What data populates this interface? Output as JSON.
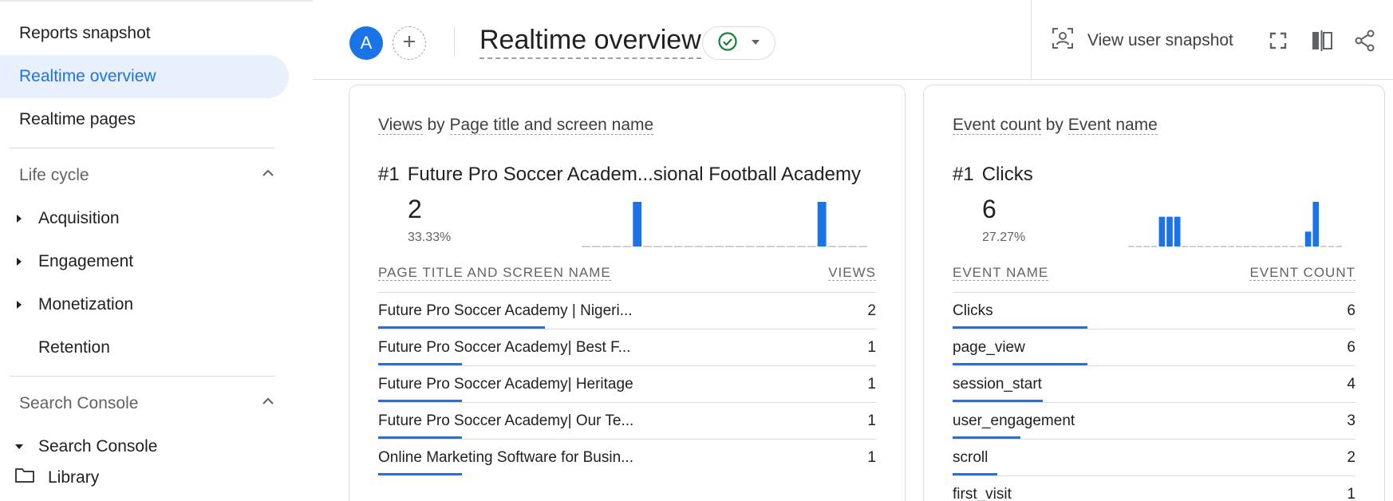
{
  "sidebar": {
    "items": [
      {
        "label": "Reports snapshot"
      },
      {
        "label": "Realtime overview"
      },
      {
        "label": "Realtime pages"
      }
    ],
    "sections": [
      {
        "label": "Life cycle",
        "children": [
          {
            "label": "Acquisition"
          },
          {
            "label": "Engagement"
          },
          {
            "label": "Monetization"
          },
          {
            "label": "Retention"
          }
        ]
      },
      {
        "label": "Search Console",
        "children": [
          {
            "label": "Search Console"
          }
        ]
      }
    ],
    "footer_label": "Library"
  },
  "header": {
    "avatar_letter": "A",
    "title": "Realtime overview",
    "view_snapshot_label": "View user snapshot"
  },
  "views_card": {
    "title_part1": "Views",
    "title_by": "by",
    "title_part2": "Page title and screen name",
    "top_rank": "#1",
    "top_name": "Future Pro Soccer Academ...sional Football Academy",
    "top_value": "2",
    "top_pct": "33.33%",
    "spark": [
      0,
      0,
      0,
      0,
      0,
      1,
      0,
      0,
      0,
      0,
      0,
      0,
      0,
      0,
      0,
      0,
      0,
      0,
      0,
      0,
      0,
      0,
      0,
      1,
      0,
      0,
      0,
      0
    ],
    "col_name": "PAGE TITLE AND SCREEN NAME",
    "col_value": "VIEWS",
    "rows": [
      {
        "name": "Future Pro Soccer Academy | Nigeri...",
        "value": "2",
        "share": 1.0
      },
      {
        "name": "Future Pro Soccer Academy| Best F...",
        "value": "1",
        "share": 0.5
      },
      {
        "name": "Future Pro Soccer Academy| Heritage",
        "value": "1",
        "share": 0.5
      },
      {
        "name": "Future Pro Soccer Academy| Our Te...",
        "value": "1",
        "share": 0.5
      },
      {
        "name": "Online Marketing Software for Busin...",
        "value": "1",
        "share": 0.5
      }
    ]
  },
  "events_card": {
    "title_part1": "Event count",
    "title_by": "by",
    "title_part2": "Event name",
    "top_rank": "#1",
    "top_name": "Clicks",
    "top_value": "6",
    "top_pct": "27.27%",
    "spark": [
      0,
      0,
      0,
      0,
      2,
      2,
      2,
      0,
      0,
      0,
      0,
      0,
      0,
      0,
      0,
      0,
      0,
      0,
      0,
      0,
      0,
      0,
      0,
      1,
      3,
      0,
      0,
      0
    ],
    "col_name": "EVENT NAME",
    "col_value": "EVENT COUNT",
    "rows": [
      {
        "name": "Clicks",
        "value": "6",
        "share": 1.0
      },
      {
        "name": "page_view",
        "value": "6",
        "share": 1.0
      },
      {
        "name": "session_start",
        "value": "4",
        "share": 0.6667
      },
      {
        "name": "user_engagement",
        "value": "3",
        "share": 0.5
      },
      {
        "name": "scroll",
        "value": "2",
        "share": 0.3333
      },
      {
        "name": "first_visit",
        "value": "1",
        "share": 0.1667
      }
    ]
  },
  "colors": {
    "accent": "#1a73e8",
    "active_bg": "#e8f0fe",
    "success": "#188038"
  }
}
